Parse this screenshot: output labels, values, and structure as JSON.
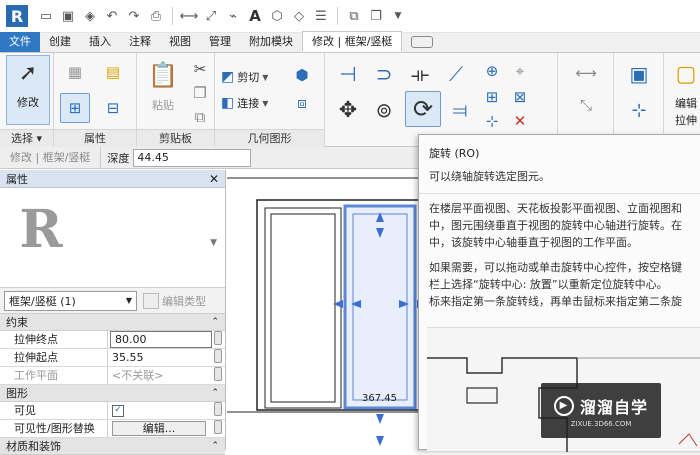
{
  "qat": {
    "logo": "R",
    "icons": [
      "open-folder-icon",
      "save-icon",
      "sync-icon",
      "undo-icon",
      "redo-icon",
      "print-icon",
      "measure-icon",
      "dimension-icon",
      "tag-icon",
      "text-icon",
      "3d-view-icon",
      "section-icon",
      "thin-lines-icon",
      "close-hidden-icon",
      "switch-windows-icon",
      "dropdown-icon"
    ]
  },
  "tabs": {
    "items": [
      "文件",
      "创建",
      "插入",
      "注释",
      "视图",
      "管理",
      "附加模块",
      "修改 | 框架/竖梃"
    ],
    "active_index": 7
  },
  "ribbon": {
    "modify_label": "修改",
    "paste_label": "粘贴",
    "cut_label": "剪切",
    "join_label": "连接",
    "edit_label": "编辑",
    "stretch_label": "拉伸",
    "panels": {
      "select": "选择",
      "properties": "属性",
      "clipboard": "剪贴板",
      "geometry": "几何图形"
    }
  },
  "options_bar": {
    "context": "修改 | 框架/竖梃",
    "depth_label": "深度",
    "depth_value": "44.45"
  },
  "properties": {
    "title": "属性",
    "thumb_letter": "R",
    "type_selector": "框架/竖梃 (1)",
    "edit_type": "编辑类型",
    "sections": [
      {
        "name": "约束",
        "rows": [
          {
            "name": "拉伸终点",
            "value": "80.00"
          },
          {
            "name": "拉伸起点",
            "value": "35.55"
          },
          {
            "name": "工作平面",
            "value": "<不关联>"
          }
        ]
      },
      {
        "name": "图形",
        "rows": [
          {
            "name": "可见",
            "value": "✓"
          },
          {
            "name": "可见性/图形替换",
            "value": "编辑..."
          }
        ]
      },
      {
        "name": "材质和装饰",
        "rows": []
      }
    ]
  },
  "canvas": {
    "dimension": "367.45"
  },
  "tooltip": {
    "title": "旋转 (RO)",
    "summary": "可以绕轴旋转选定图元。",
    "para1": [
      "在楼层平面视图、天花板投影平面视图、立面视图和",
      "中，图元围绕垂直于视图的旋转中心轴进行旋转。在",
      "中，该旋转中心轴垂直于视图的工作平面。"
    ],
    "para2": [
      "如果需要，可以拖动或单击旋转中心控件，按空格键",
      "栏上选择“旋转中心: 放置”以重新定位旋转中心。",
      "标来指定第一条旋转线，再单击鼠标来指定第二条旋"
    ]
  },
  "watermark": {
    "text": "溜溜自学",
    "url": "ZIXUE.3D66.COM"
  },
  "colors": {
    "accent": "#2f78c4",
    "selection": "#5b87d6",
    "arrow": "#ef6a1f"
  }
}
